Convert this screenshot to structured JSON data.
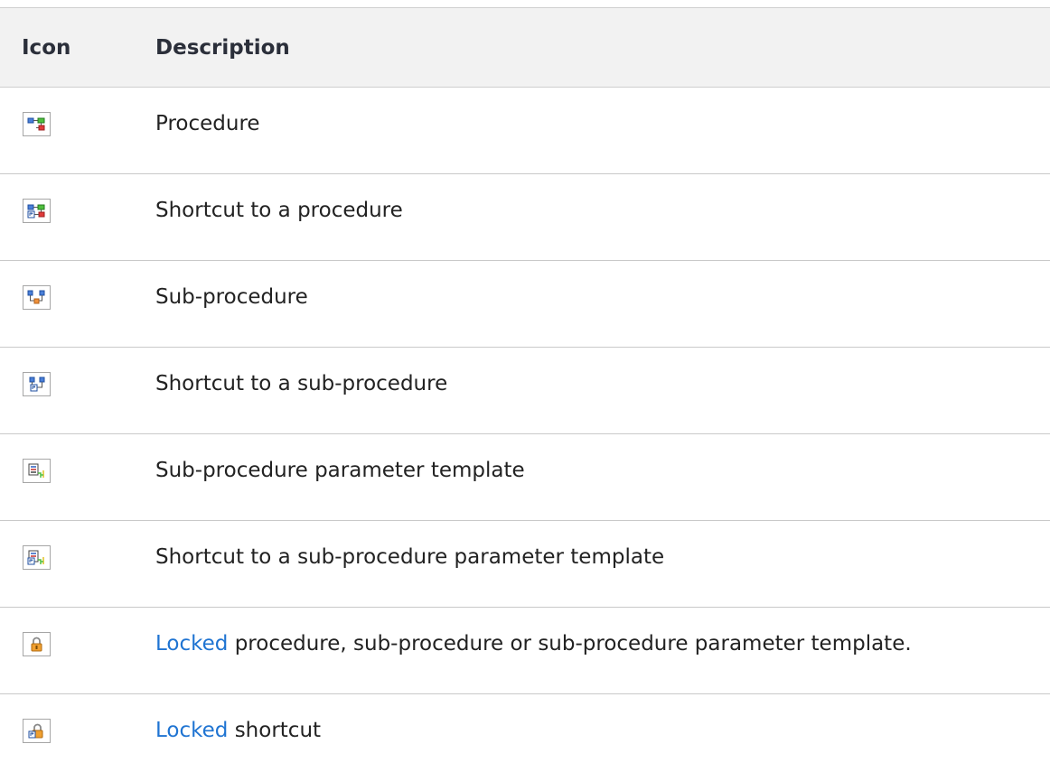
{
  "table": {
    "headers": {
      "icon": "Icon",
      "description": "Description"
    },
    "rows": [
      {
        "icon": "procedure-icon",
        "description": "Procedure"
      },
      {
        "icon": "procedure-shortcut-icon",
        "description": "Shortcut to a procedure"
      },
      {
        "icon": "sub-procedure-icon",
        "description": "Sub-procedure"
      },
      {
        "icon": "sub-procedure-shortcut-icon",
        "description": "Shortcut to a sub-procedure"
      },
      {
        "icon": "parameter-template-icon",
        "description": "Sub-procedure parameter template"
      },
      {
        "icon": "parameter-template-shortcut-icon",
        "description": "Shortcut to a sub-procedure parameter template"
      },
      {
        "icon": "lock-icon",
        "link": "Locked",
        "description": " procedure, sub-procedure or sub-procedure parameter template."
      },
      {
        "icon": "locked-shortcut-icon",
        "link": "Locked",
        "description": " shortcut"
      }
    ]
  },
  "colors": {
    "header_background": "#f2f2f2",
    "link": "#1f74d2",
    "text": "#222222"
  }
}
